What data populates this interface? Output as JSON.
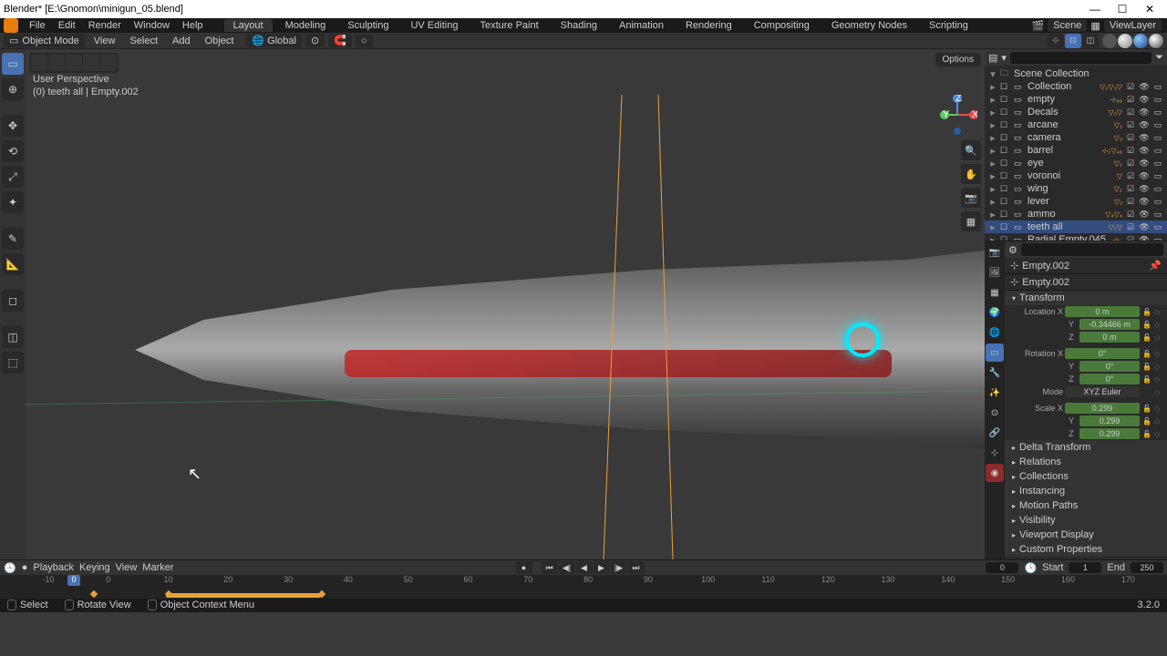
{
  "window": {
    "title": "Blender* [E:\\Gnomon\\minigun_05.blend]"
  },
  "menu": {
    "file": "File",
    "edit": "Edit",
    "render": "Render",
    "window": "Window",
    "help": "Help"
  },
  "tabs": [
    "Layout",
    "Modeling",
    "Sculpting",
    "UV Editing",
    "Texture Paint",
    "Shading",
    "Animation",
    "Rendering",
    "Compositing",
    "Geometry Nodes",
    "Scripting"
  ],
  "active_tab": "Layout",
  "top_right": {
    "scene": "Scene",
    "viewlayer": "ViewLayer"
  },
  "header": {
    "mode": "Object Mode",
    "view": "View",
    "select": "Select",
    "add": "Add",
    "object": "Object",
    "orientation": "Global"
  },
  "viewport": {
    "perspective": "User Perspective",
    "context": "(0) teeth all | Empty.002",
    "options": "Options"
  },
  "outliner": {
    "scene_collection": "Scene Collection",
    "items": [
      {
        "name": "Collection",
        "tag": "▽₂▽₃▽"
      },
      {
        "name": "empty",
        "tag": "⊹₉₉"
      },
      {
        "name": "Decals",
        "tag": "▽₃▽"
      },
      {
        "name": "arcane",
        "tag": "▽₂"
      },
      {
        "name": "camera",
        "tag": "▽₃"
      },
      {
        "name": "barrel",
        "tag": "⊹₂▽₄₉"
      },
      {
        "name": "eye",
        "tag": "▽₂"
      },
      {
        "name": "voronoi",
        "tag": "▽"
      },
      {
        "name": "wing",
        "tag": "▽₂"
      },
      {
        "name": "lever",
        "tag": "▽₂"
      },
      {
        "name": "ammo",
        "tag": "▽₄▽₄"
      },
      {
        "name": "teeth all",
        "tag": "▽₂▽",
        "sel": true
      },
      {
        "name": "Radial Empty.045",
        "tag": "⊹₄"
      }
    ]
  },
  "properties": {
    "object": "Empty.002",
    "breadcrumb": "Empty.002",
    "transform": {
      "title": "Transform",
      "location": {
        "label": "Location X",
        "x": "0 m",
        "y": "-0.34466 m",
        "z": "0 m"
      },
      "rotation": {
        "label": "Rotation X",
        "x": "0°",
        "y": "0°",
        "z": "0°"
      },
      "mode_label": "Mode",
      "mode": "XYZ Euler",
      "scale": {
        "label": "Scale X",
        "x": "0.299",
        "y": "0.299",
        "z": "0.299"
      }
    },
    "panels": [
      "Delta Transform",
      "Relations",
      "Collections",
      "Instancing",
      "Motion Paths",
      "Visibility",
      "Viewport Display",
      "Custom Properties"
    ]
  },
  "timeline": {
    "playback": "Playback",
    "keying": "Keying",
    "view": "View",
    "marker": "Marker",
    "current": "0",
    "start_label": "Start",
    "start": "1",
    "end_label": "End",
    "end": "250",
    "ticks": [
      "-10",
      "0",
      "10",
      "20",
      "30",
      "40",
      "50",
      "60",
      "70",
      "80",
      "90",
      "100",
      "110",
      "120",
      "130",
      "140",
      "150",
      "160",
      "170"
    ]
  },
  "status": {
    "select": "Select",
    "rotate": "Rotate View",
    "context": "Object Context Menu"
  },
  "version": "3.2.0"
}
